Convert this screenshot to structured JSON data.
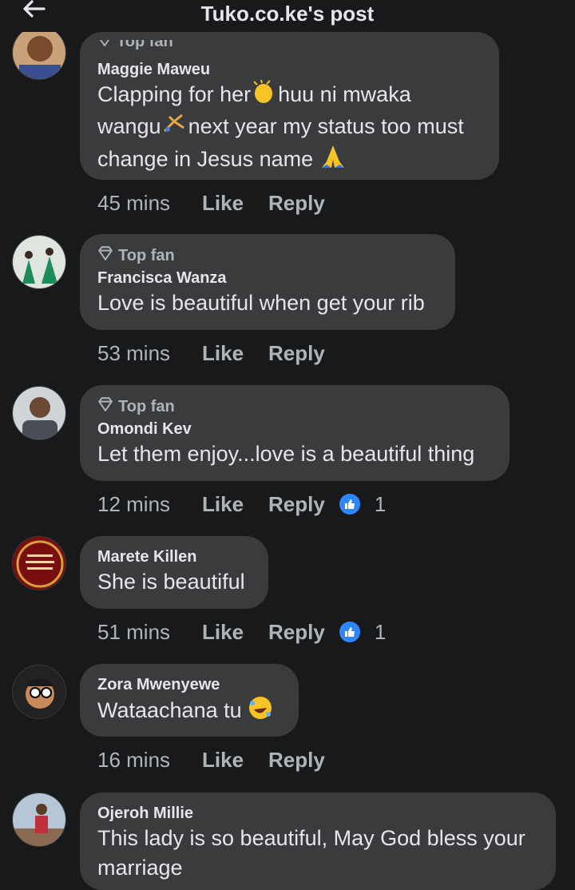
{
  "header": {
    "title": "Tuko.co.ke's post",
    "back_icon": "arrow-left-icon"
  },
  "comments": [
    {
      "badge": "Top fan",
      "name": "Maggie Maweu",
      "text_parts": [
        "Clapping for her",
        "huu ni mwaka",
        "wangu",
        "next year my status too must",
        "change in Jesus name "
      ],
      "time": "45 mins",
      "like": "Like",
      "reply": "Reply"
    },
    {
      "badge": "Top fan",
      "name": "Francisca Wanza",
      "text": "Love is beautiful when get your rib",
      "time": "53 mins",
      "like": "Like",
      "reply": "Reply"
    },
    {
      "badge": "Top fan",
      "name": "Omondi Kev",
      "text": "Let them enjoy...love is a beautiful thing",
      "time": "12 mins",
      "like": "Like",
      "reply": "Reply",
      "reactions": "1"
    },
    {
      "name": "Marete Killen",
      "text": "She is beautiful",
      "time": "51 mins",
      "like": "Like",
      "reply": "Reply",
      "reactions": "1"
    },
    {
      "name": "Zora Mwenyewe",
      "text": "Wataachana tu ",
      "time": "16 mins",
      "like": "Like",
      "reply": "Reply"
    },
    {
      "name": "Ojeroh Millie",
      "text_lines": [
        "This lady is so beautiful, May God bless your",
        "marriage"
      ]
    }
  ],
  "colors": {
    "background": "#18191a",
    "bubble": "#3a3b3c",
    "like_badge": "#2d88ff"
  }
}
